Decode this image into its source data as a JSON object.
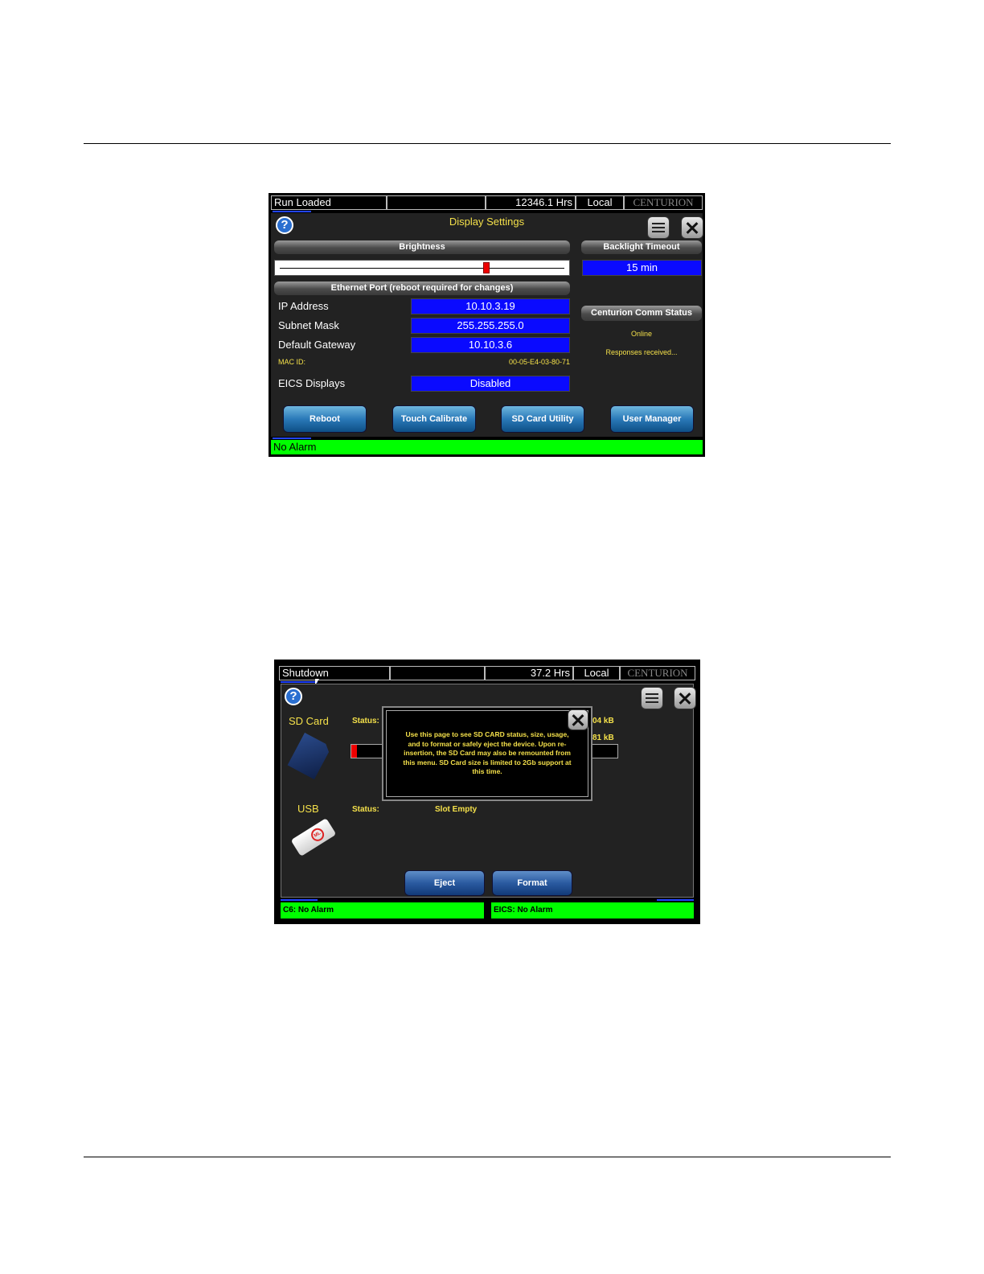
{
  "screen1": {
    "status_bar": {
      "state": "Run Loaded",
      "hours": "12346.1 Hrs",
      "mode": "Local",
      "brand": "CENTURION"
    },
    "title": "Display Settings",
    "brightness": {
      "header": "Brightness",
      "level": 0.73
    },
    "backlight": {
      "header": "Backlight Timeout",
      "value": "15 min"
    },
    "ethernet": {
      "header": "Ethernet Port (reboot required for changes)",
      "rows": [
        {
          "label": "IP Address",
          "value": "10.10.3.19"
        },
        {
          "label": "Subnet Mask",
          "value": "255.255.255.0"
        },
        {
          "label": "Default Gateway",
          "value": "10.10.3.6"
        }
      ],
      "mac_label": "MAC ID:",
      "mac_value": "00-05-E4-03-80-71"
    },
    "eics": {
      "label": "EICS Displays",
      "value": "Disabled"
    },
    "comm_status": {
      "header": "Centurion Comm Status",
      "status": "Online",
      "detail": "Responses received..."
    },
    "buttons": {
      "reboot": "Reboot",
      "touch": "Touch Calibrate",
      "sd": "SD Card Utility",
      "user": "User Manager"
    },
    "alarm": "No Alarm",
    "colors": {
      "field_blue": "#0a0aff",
      "alarm_green": "#00ff00",
      "title_yellow": "#f4e04a"
    }
  },
  "screen2": {
    "status_bar": {
      "state": "Shutdown",
      "hours": "37.2 Hrs",
      "mode": "Local",
      "brand": "CENTURION"
    },
    "sd": {
      "label": "SD Card",
      "status_label": "Status:",
      "line1_suffix": "04 kB",
      "line2_suffix": "81 kB"
    },
    "usb": {
      "label": "USB",
      "status_label": "Status:",
      "status_value": "Slot Empty",
      "logo_text": "ML"
    },
    "popup_text": "Use this page to see SD CARD status, size, usage, and to format or safely eject the device.  Upon re-insertion, the SD Card may also be remounted from this menu.  SD Card size is limited to 2Gb support at this time.",
    "buttons": {
      "eject": "Eject",
      "format": "Format"
    },
    "alarms": {
      "left": "C6: No Alarm",
      "right": "EICS: No Alarm"
    }
  }
}
